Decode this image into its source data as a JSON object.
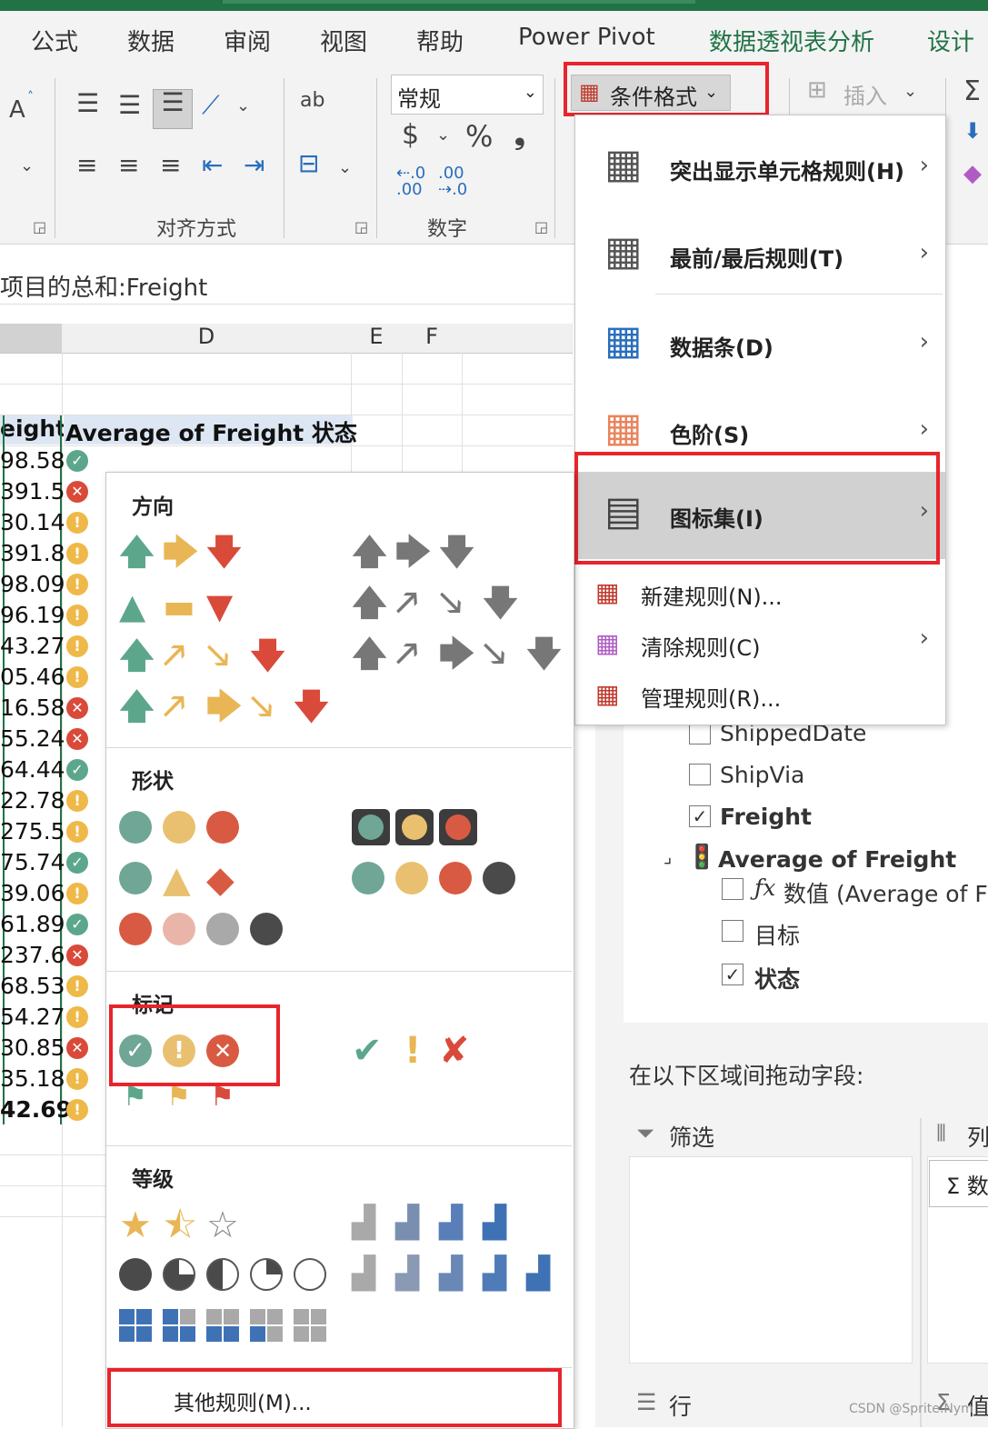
{
  "tabs": [
    "公式",
    "数据",
    "审阅",
    "视图",
    "帮助",
    "Power Pivot",
    "数据透视表分析",
    "设计"
  ],
  "ribbon": {
    "font_size_glyph": "A",
    "number_format": "常规",
    "currency": "$",
    "percent": "%",
    "comma": "❟",
    "align_group": "对齐方式",
    "number_group": "数字",
    "cf_label": "条件格式",
    "insert_label": "插入",
    "sigma": "Σ"
  },
  "formula_bar": {
    "text": "项目的总和:Freight"
  },
  "sheet": {
    "columns": [
      "D",
      "E",
      "F"
    ],
    "header_c": "eight",
    "header_d": "Average of Freight 状态",
    "rows": [
      {
        "v": "98.58",
        "s": "ok"
      },
      {
        "v": "391.5",
        "s": "bad"
      },
      {
        "v": "30.14",
        "s": "warn"
      },
      {
        "v": "391.8",
        "s": "warn"
      },
      {
        "v": "98.09",
        "s": "warn"
      },
      {
        "v": "96.19",
        "s": "warn"
      },
      {
        "v": "43.27",
        "s": "warn"
      },
      {
        "v": "05.46",
        "s": "warn"
      },
      {
        "v": "16.58",
        "s": "bad"
      },
      {
        "v": "55.24",
        "s": "bad"
      },
      {
        "v": "64.44",
        "s": "ok"
      },
      {
        "v": "22.78",
        "s": "warn"
      },
      {
        "v": "275.5",
        "s": "warn"
      },
      {
        "v": "75.74",
        "s": "ok"
      },
      {
        "v": "39.06",
        "s": "warn"
      },
      {
        "v": "61.89",
        "s": "ok"
      },
      {
        "v": "237.6",
        "s": "bad"
      },
      {
        "v": "68.53",
        "s": "warn"
      },
      {
        "v": "54.27",
        "s": "warn"
      },
      {
        "v": "30.85",
        "s": "bad"
      },
      {
        "v": "35.18",
        "s": "warn"
      },
      {
        "v": "42.69",
        "s": "warn"
      }
    ]
  },
  "cf_menu": {
    "items": [
      {
        "label": "突出显示单元格规则(H)",
        "sub": true
      },
      {
        "label": "最前/最后规则(T)",
        "sub": true
      },
      {
        "label": "数据条(D)",
        "sub": true
      },
      {
        "label": "色阶(S)",
        "sub": true
      },
      {
        "label": "图标集(I)",
        "sub": true
      }
    ],
    "small_items": [
      {
        "label": "新建规则(N)...",
        "sub": false
      },
      {
        "label": "清除规则(C)",
        "sub": true
      },
      {
        "label": "管理规则(R)...",
        "sub": false
      }
    ]
  },
  "icon_sets": {
    "sections": [
      "方向",
      "形状",
      "标记",
      "等级"
    ],
    "more_rules": "其他规则(M)..."
  },
  "pivot_panel": {
    "fields": [
      {
        "label": "ShippedDate",
        "checked": false
      },
      {
        "label": "ShipVia",
        "checked": false
      },
      {
        "label": "Freight",
        "checked": true
      }
    ],
    "kpi": "Average of Freight",
    "kpi_items": [
      {
        "label": "数值 (Average of Fre",
        "checked": false
      },
      {
        "label": "目标",
        "checked": false
      },
      {
        "label": "状态",
        "checked": true
      }
    ],
    "drag_hint": "在以下区域间拖动字段:",
    "filter": "筛选",
    "columns": "列",
    "rows": "行",
    "values": "值",
    "sum_values": "Σ 数"
  },
  "watermark": "CSDN @Sprite.Nym"
}
